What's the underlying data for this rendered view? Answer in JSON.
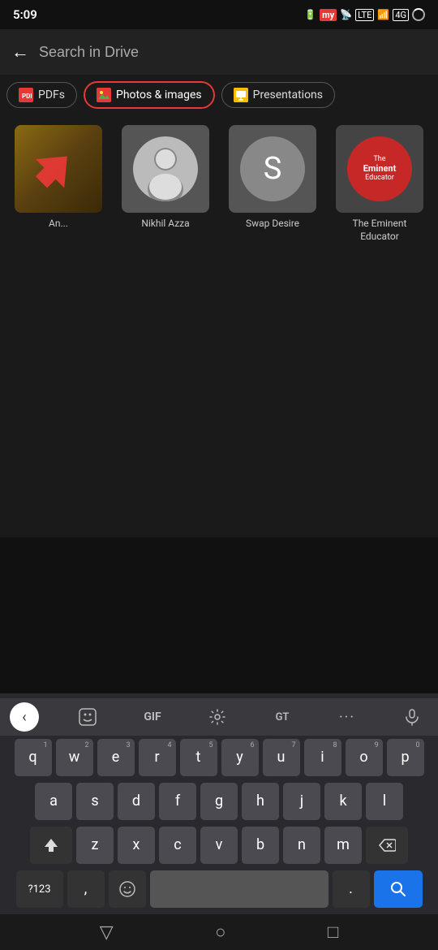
{
  "statusBar": {
    "time": "5:09",
    "icons": [
      "battery",
      "my-label",
      "cast",
      "lte",
      "signal",
      "4g",
      "loading"
    ]
  },
  "searchBar": {
    "placeholder": "Search in Drive",
    "backLabel": "←"
  },
  "filterTabs": [
    {
      "id": "pdfs",
      "label": "PDFs",
      "iconType": "pdf",
      "active": false
    },
    {
      "id": "photos",
      "label": "Photos & images",
      "iconType": "image",
      "active": true
    },
    {
      "id": "presentations",
      "label": "Presentations",
      "iconType": "presentation",
      "active": false
    }
  ],
  "gridItems": [
    {
      "id": "an",
      "label": "An...",
      "type": "blurred-arrow"
    },
    {
      "id": "nikhil",
      "label": "Nikhil Azza",
      "type": "person"
    },
    {
      "id": "swap",
      "label": "Swap Desire",
      "type": "letter",
      "letter": "S"
    },
    {
      "id": "educator",
      "label": "The Eminent Educator",
      "type": "educator",
      "line1": "The Eminent",
      "line2": "Educator"
    }
  ],
  "keyboard": {
    "toolbar": {
      "leftArrow": "‹",
      "emojiSticker": "☺",
      "gif": "GIF",
      "settings": "⚙",
      "translate": "GT",
      "more": "···",
      "mic": "🎤"
    },
    "rows": [
      {
        "keys": [
          {
            "main": "q",
            "num": "1"
          },
          {
            "main": "w",
            "num": "2"
          },
          {
            "main": "e",
            "num": "3"
          },
          {
            "main": "r",
            "num": "4"
          },
          {
            "main": "t",
            "num": "5"
          },
          {
            "main": "y",
            "num": "6"
          },
          {
            "main": "u",
            "num": "7"
          },
          {
            "main": "i",
            "num": "8"
          },
          {
            "main": "o",
            "num": "9"
          },
          {
            "main": "p",
            "num": "0"
          }
        ]
      },
      {
        "keys": [
          {
            "main": "a"
          },
          {
            "main": "s"
          },
          {
            "main": "d"
          },
          {
            "main": "f"
          },
          {
            "main": "g"
          },
          {
            "main": "h"
          },
          {
            "main": "j"
          },
          {
            "main": "k"
          },
          {
            "main": "l"
          }
        ]
      },
      {
        "keys": [
          {
            "main": "⬆",
            "type": "shift"
          },
          {
            "main": "z"
          },
          {
            "main": "x"
          },
          {
            "main": "c"
          },
          {
            "main": "v"
          },
          {
            "main": "b"
          },
          {
            "main": "n"
          },
          {
            "main": "m"
          },
          {
            "main": "⌫",
            "type": "backspace"
          }
        ]
      }
    ],
    "bottomRow": {
      "specialLabel": "?123",
      "comma": ",",
      "emoji": "☺",
      "space": "",
      "period": ".",
      "searchIcon": "🔍"
    }
  },
  "navBar": {
    "back": "▽",
    "home": "○",
    "recents": "□"
  }
}
